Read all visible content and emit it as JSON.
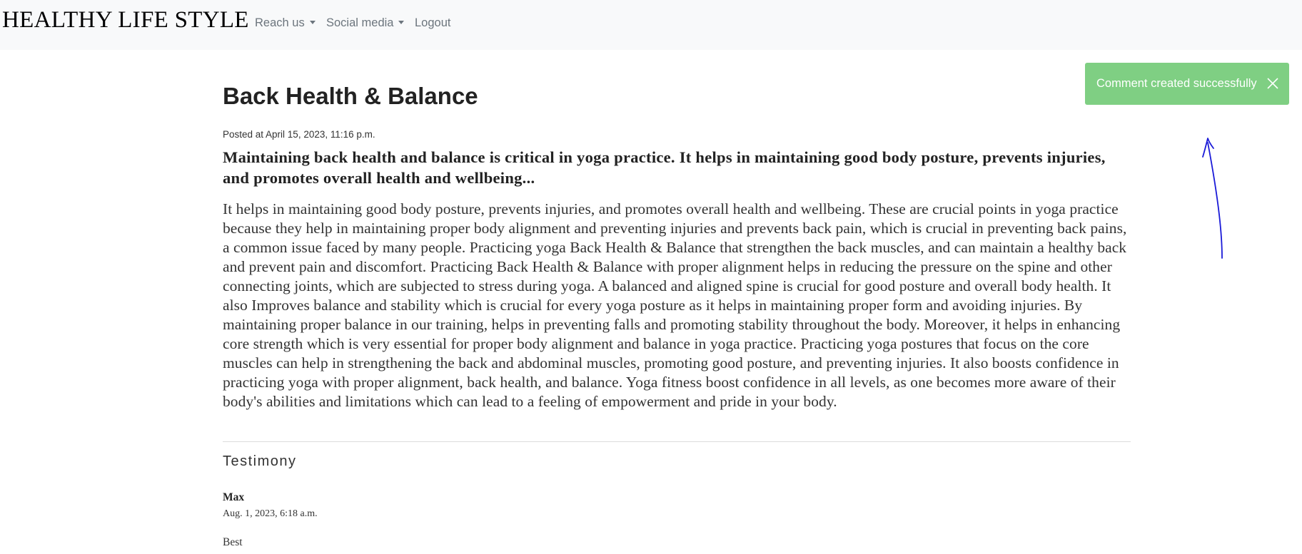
{
  "navbar": {
    "brand": "HEALTHY LIFE STYLE",
    "items": [
      {
        "label": "Reach us",
        "dropdown": true
      },
      {
        "label": "Social media",
        "dropdown": true
      },
      {
        "label": "Logout",
        "dropdown": false
      }
    ],
    "background": "#f8f9fa"
  },
  "toast": {
    "message": "Comment created successfully",
    "close_icon": "close-icon",
    "color": "#7fcf83"
  },
  "annotation": {
    "arrow_icon": "hand-drawn-arrow-up-icon",
    "color": "#1a1ad8"
  },
  "post": {
    "title": "Back Health & Balance",
    "posted_at": "Posted at April 15, 2023, 11:16 p.m.",
    "lead": "Maintaining back health and balance is critical in yoga practice. It helps in maintaining good body posture, prevents injuries, and promotes overall health and wellbeing...",
    "body": "It helps in maintaining good body posture, prevents injuries, and promotes overall health and wellbeing. These are crucial points in yoga practice because they help in maintaining proper body alignment and preventing injuries and prevents back pain, which is crucial in preventing back pains, a common issue faced by many people. Practicing yoga Back Health & Balance that strengthen the back muscles, and can maintain a healthy back and prevent pain and discomfort. Practicing Back Health & Balance with proper alignment helps in reducing the pressure on the spine and other connecting joints, which are subjected to stress during yoga. A balanced and aligned spine is crucial for good posture and overall body health. It also Improves balance and stability which is crucial for every yoga posture as it helps in maintaining proper form and avoiding injuries. By maintaining proper balance in our training, helps in preventing falls and promoting stability throughout the body. Moreover, it helps in enhancing core strength which is very essential for proper body alignment and balance in yoga practice. Practicing yoga postures that focus on the core muscles can help in strengthening the back and abdominal muscles, promoting good posture, and preventing injuries. It also boosts confidence in practicing yoga with proper alignment, back health, and balance. Yoga fitness boost confidence in all levels, as one becomes more aware of their body's abilities and limitations which can lead to a feeling of empowerment and pride in your body."
  },
  "testimony": {
    "heading": "Testimony",
    "comments": [
      {
        "author": "Max",
        "date": "Aug. 1, 2023, 6:18 a.m.",
        "text": "Best"
      }
    ]
  }
}
